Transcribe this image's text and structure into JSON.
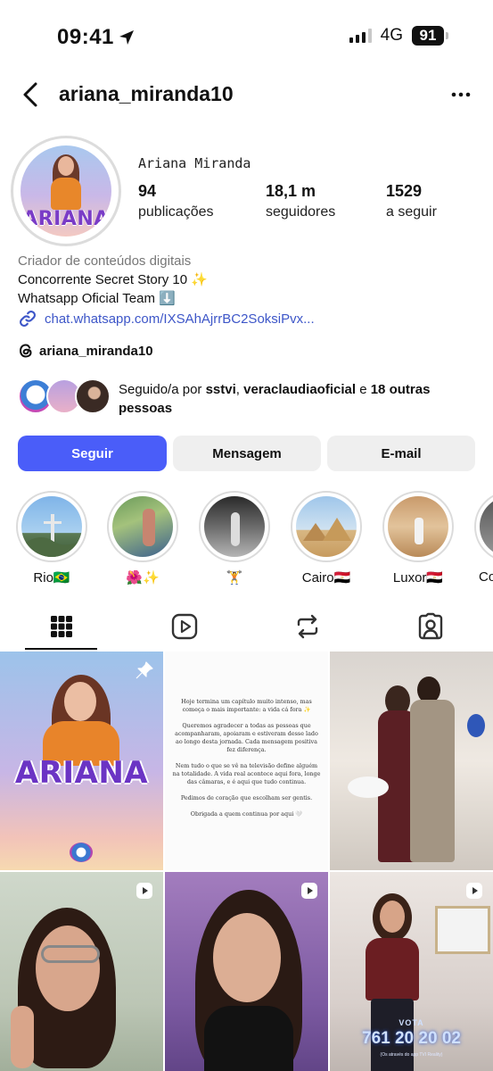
{
  "status_bar": {
    "time": "09:41",
    "network": "4G",
    "battery": "91"
  },
  "header": {
    "username": "ariana_miranda10"
  },
  "profile": {
    "full_name": "Ariana Miranda",
    "avatar_text": "ARIANA",
    "stats": [
      {
        "value": "94",
        "label": "publicações"
      },
      {
        "value": "18,1 m",
        "label": "seguidores"
      },
      {
        "value": "1529",
        "label": "a seguir"
      }
    ],
    "category": "Criador de conteúdos digitais",
    "bio_lines": [
      "Concorrente Secret Story 10 ✨",
      "Whatsapp Oficial Team ⬇️"
    ],
    "link": "chat.whatsapp.com/IXSAhAjrrBC2SoksiPvx...",
    "threads_handle": "ariana_miranda10",
    "followed_by": {
      "prefix": "Seguido/a por ",
      "user1": "sstvi",
      "sep": ", ",
      "user2": "veraclaudiaoficial",
      "suffix": " e ",
      "others": "18 outras",
      "last": "pessoas"
    }
  },
  "actions": {
    "follow": "Seguir",
    "message": "Mensagem",
    "email": "E-mail"
  },
  "highlights": [
    {
      "label": "Rio🇧🇷"
    },
    {
      "label": "🌺✨"
    },
    {
      "label": "🏋️"
    },
    {
      "label": "Cairo🇪🇬"
    },
    {
      "label": "Luxor🇪🇬"
    },
    {
      "label": "Co"
    }
  ],
  "posts": {
    "post1_text": "ARIANA",
    "post2_paragraphs": [
      "Hoje termina um capítulo muito intenso, mas começa o mais importante: a vida cá fora ✨",
      "Queremos agradecer a todas as pessoas que acompanharam, apoiaram e estiveram desse lado ao longo desta jornada. Cada mensagem positiva fez diferença.",
      "Nem tudo o que se vê na televisão define alguém na totalidade. A vida real acontece aqui fora, longe das câmaras, e é aqui que tudo continua.",
      "Pedimos de coração que escolham ser gentis.",
      "Obrigada a quem continua por aqui 🤍"
    ],
    "post6_vote_label": "VOTA",
    "post6_vote_number": "761 20 20 02",
    "post6_caption": "(Os através do app TVI Reality)"
  },
  "colors": {
    "follow_button": "#4a5df9",
    "link": "#3d56c8"
  }
}
